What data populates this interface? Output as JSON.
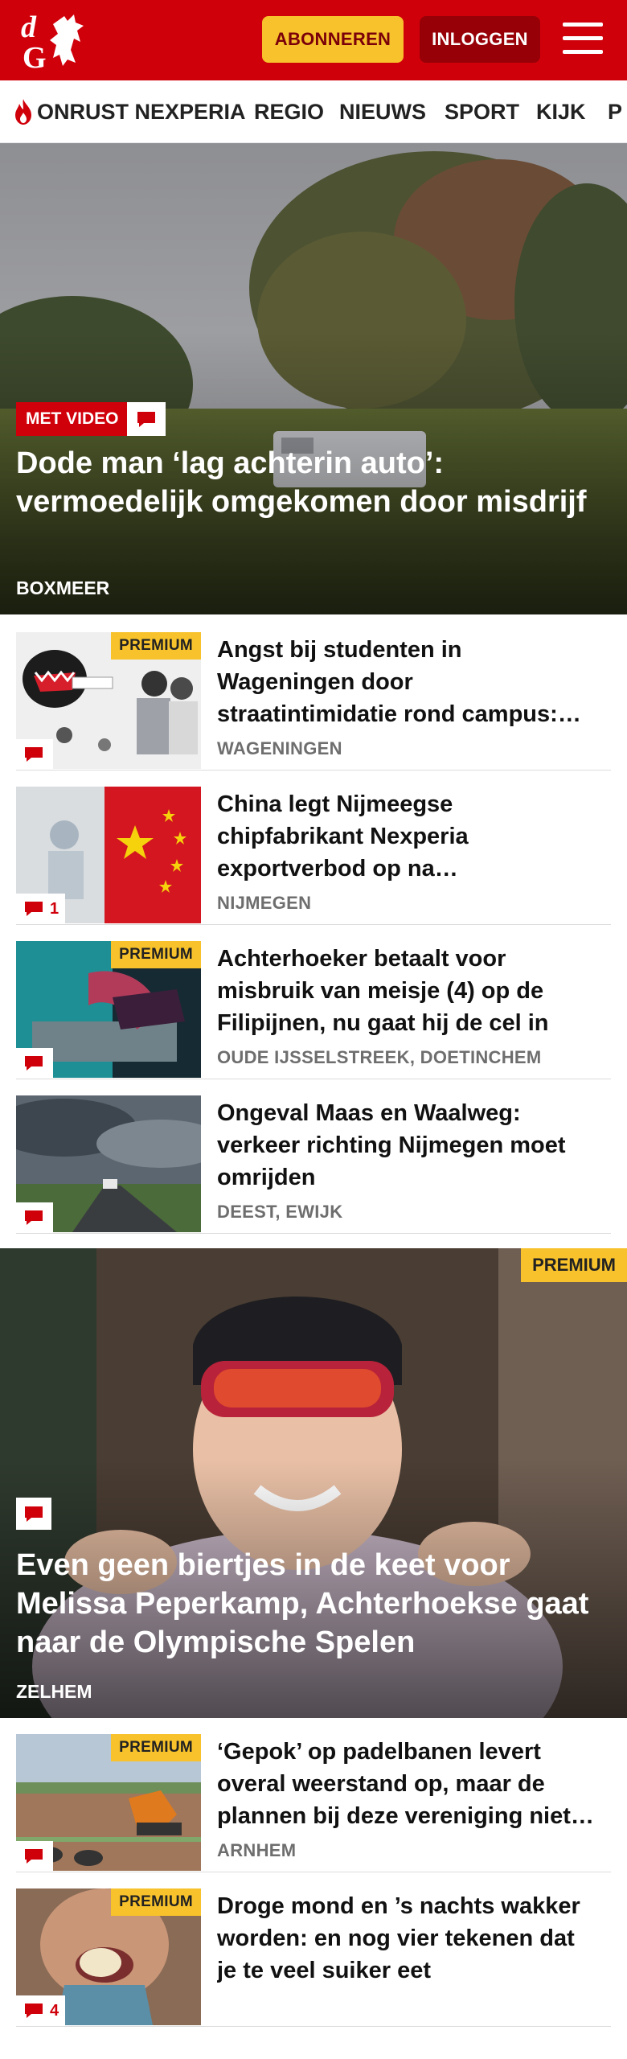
{
  "header": {
    "logo_text": "dG",
    "subscribe_label": "ABONNEREN",
    "login_label": "INLOGGEN",
    "menu_icon": "hamburger-menu-icon",
    "brand_color": "#d0000b",
    "accent_color": "#f7c22b"
  },
  "nav": {
    "items": [
      {
        "label": "ONRUST NEXPERIA",
        "icon": "flame-icon"
      },
      {
        "label": "REGIO"
      },
      {
        "label": "NIEUWS"
      },
      {
        "label": "SPORT"
      },
      {
        "label": "KIJK"
      },
      {
        "label": "P"
      }
    ]
  },
  "hero": {
    "badge": "MET VIDEO",
    "title": "Dode man ‘lag achterin auto’: vermoedelijk omgekomen door misdrijf",
    "location": "BOXMEER"
  },
  "articles": [
    {
      "title": "Angst bij studenten in Wageningen door straatintimidatie rond campus: ‘Durf daar niet meer alleen te fietsen’",
      "location": "WAGENINGEN",
      "premium": "PREMIUM",
      "comments": ""
    },
    {
      "title": "China legt Nijmeegse chipfabrikant Nexperia exportverbod op na opzijschuiven eigenaar",
      "location": "NIJMEGEN",
      "premium": "",
      "comments": "1"
    },
    {
      "title": "Achterhoeker betaalt voor misbruik van meisje (4) op de Filipijnen, nu gaat hij de cel in",
      "location": "OUDE IJSSELSTREEK, DOETINCHEM",
      "premium": "PREMIUM",
      "comments": ""
    },
    {
      "title": "Ongeval Maas en Waalweg: verkeer richting Nijmegen moet omrijden",
      "location": "DEEST, EWIJK",
      "premium": "",
      "comments": ""
    }
  ],
  "feature": {
    "premium": "PREMIUM",
    "title": "Even geen biertjes in de keet voor Melissa Peperkamp, Achterhoekse gaat naar de Olympische Spelen",
    "location": "ZELHEM"
  },
  "articles2": [
    {
      "title": "‘Gepok’ op padelbanen levert overal weerstand op, maar de plannen bij deze vereniging niet tegengehouden",
      "location": "ARNHEM",
      "premium": "PREMIUM",
      "comments": ""
    },
    {
      "title": "Droge mond en ’s nachts wakker worden: en nog vier tekenen dat je te veel suiker eet",
      "location": "",
      "premium": "PREMIUM",
      "comments": "4"
    }
  ]
}
